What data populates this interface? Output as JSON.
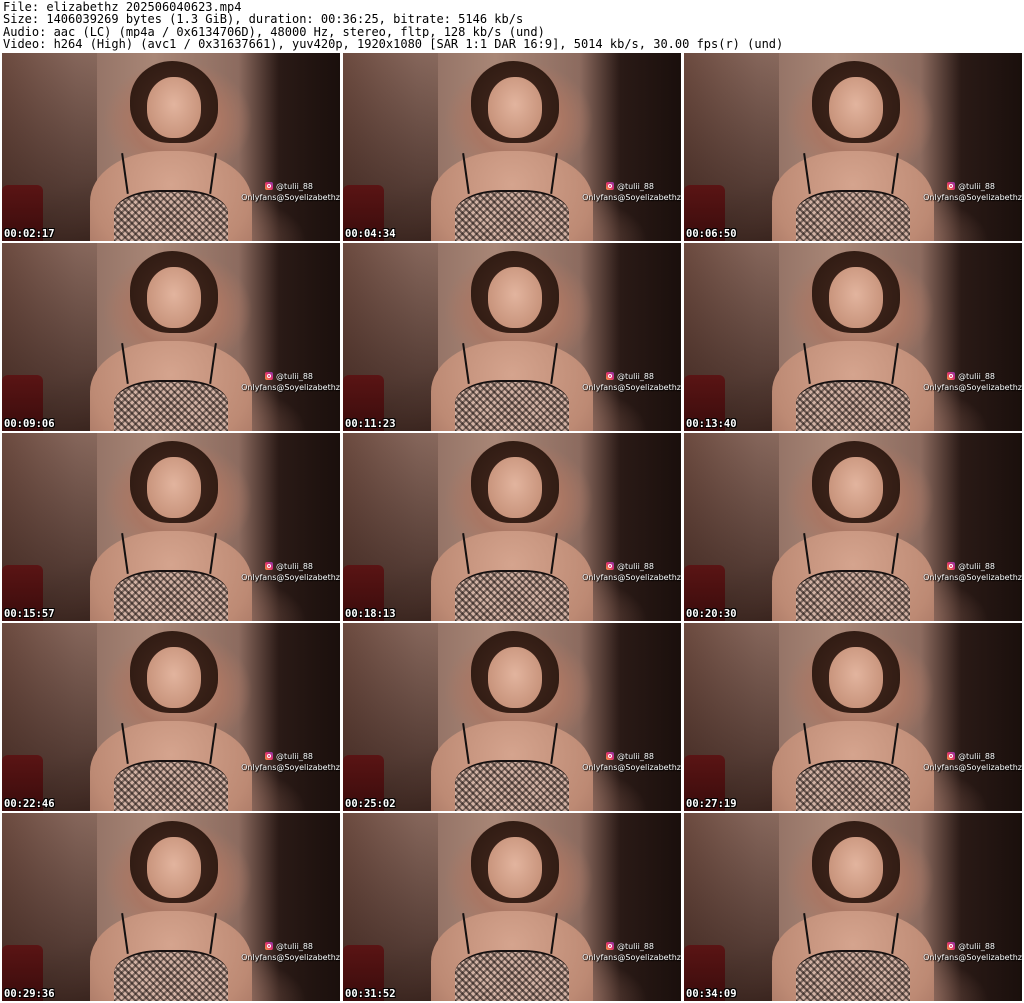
{
  "header": {
    "file_line": "File: elizabethz_202506040623.mp4",
    "size_line": "Size: 1406039269 bytes (1.3 GiB), duration: 00:36:25, bitrate: 5146 kb/s",
    "audio_line": "Audio: aac (LC) (mp4a / 0x6134706D), 48000 Hz, stereo, fltp, 128 kb/s (und)",
    "video_line": "Video: h264 (High) (avc1 / 0x31637661), yuv420p, 1920x1080 [SAR 1:1 DAR 16:9], 5014 kb/s, 30.00 fps(r) (und)"
  },
  "watermark": {
    "instagram_handle": "@tulii_88",
    "onlyfans_text": "Onlyfans@Soyelizabethz",
    "icon": "instagram-icon"
  },
  "thumbnails": [
    {
      "timestamp": "00:02:17"
    },
    {
      "timestamp": "00:04:34"
    },
    {
      "timestamp": "00:06:50"
    },
    {
      "timestamp": "00:09:06"
    },
    {
      "timestamp": "00:11:23"
    },
    {
      "timestamp": "00:13:40"
    },
    {
      "timestamp": "00:15:57"
    },
    {
      "timestamp": "00:18:13"
    },
    {
      "timestamp": "00:20:30"
    },
    {
      "timestamp": "00:22:46"
    },
    {
      "timestamp": "00:25:02"
    },
    {
      "timestamp": "00:27:19"
    },
    {
      "timestamp": "00:29:36"
    },
    {
      "timestamp": "00:31:52"
    },
    {
      "timestamp": "00:34:09"
    }
  ]
}
